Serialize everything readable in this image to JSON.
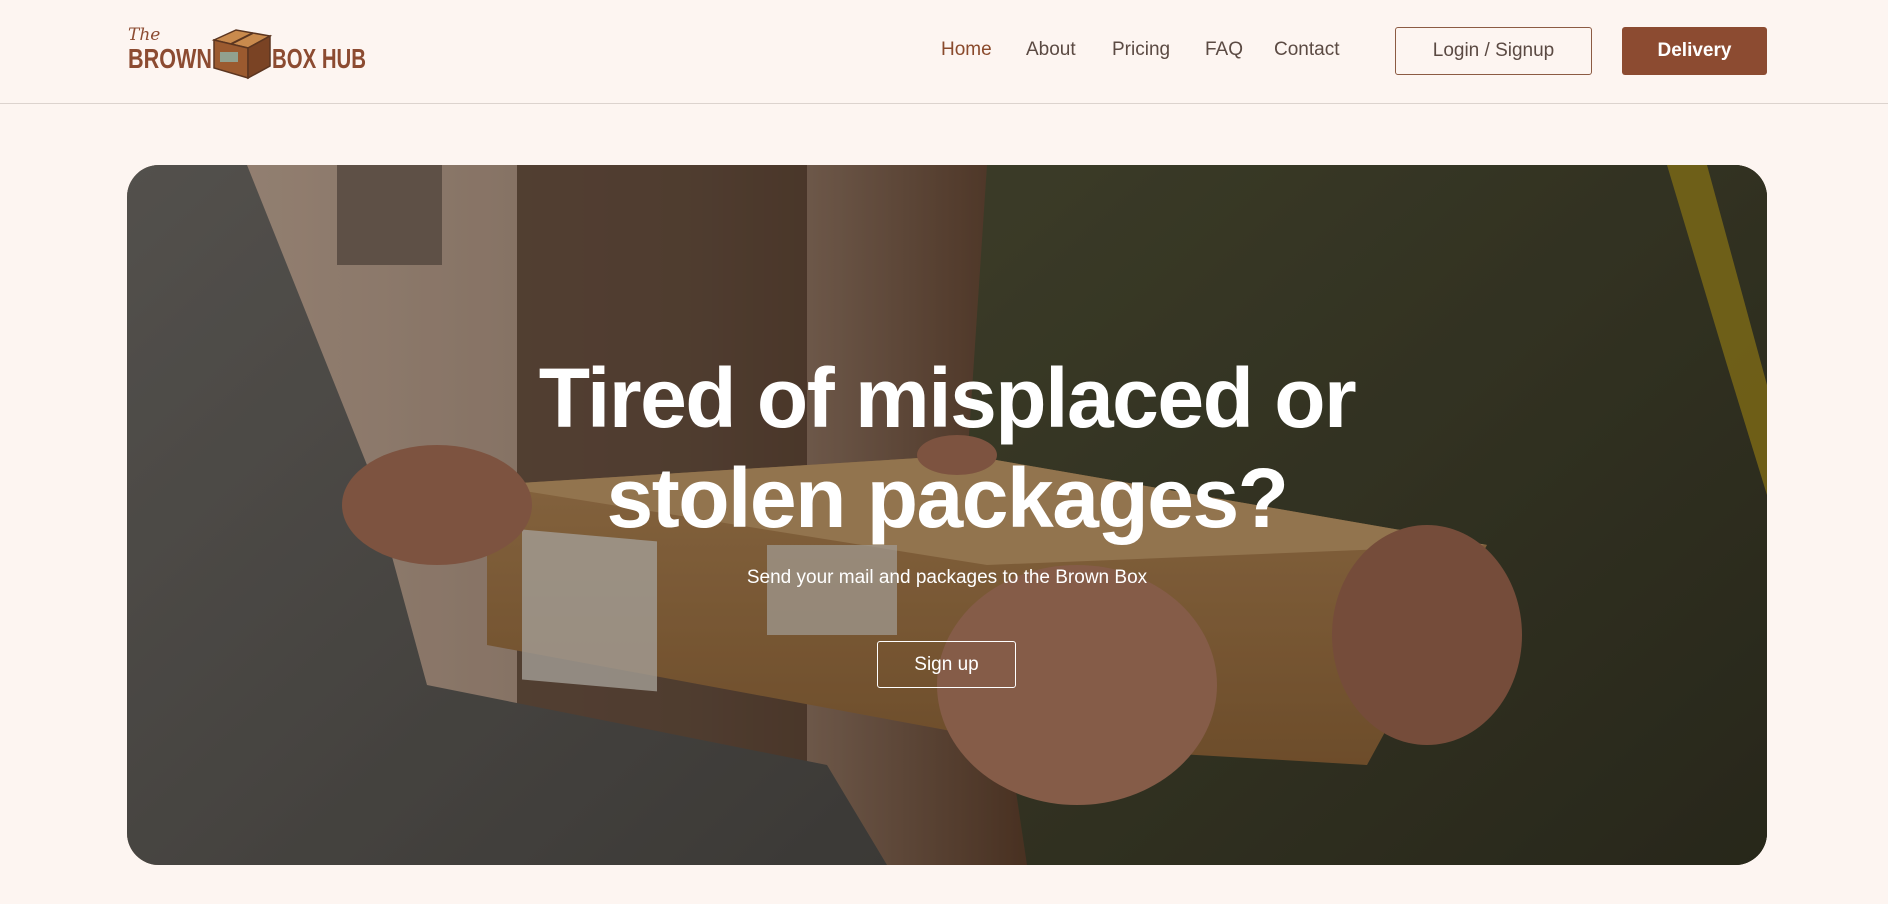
{
  "brand": {
    "logo_top": "The",
    "logo_left": "BROWN",
    "logo_right": "BOX HUB"
  },
  "nav": {
    "items": [
      {
        "label": "Home",
        "active": true
      },
      {
        "label": "About",
        "active": false
      },
      {
        "label": "Pricing",
        "active": false
      },
      {
        "label": "FAQ",
        "active": false
      },
      {
        "label": "Contact",
        "active": false
      }
    ],
    "login_label": "Login / Signup",
    "delivery_label": "Delivery"
  },
  "hero": {
    "title_line1": "Tired of misplaced or",
    "title_line2": "stolen packages?",
    "subtitle": "Send your mail and packages to the Brown Box",
    "cta_label": "Sign up",
    "image_icon": "package-handoff-photo"
  },
  "colors": {
    "background": "#fdf5f1",
    "brand_brown": "#8c4b31",
    "nav_text": "#5b4a43",
    "nav_active": "#8a4a2c"
  }
}
